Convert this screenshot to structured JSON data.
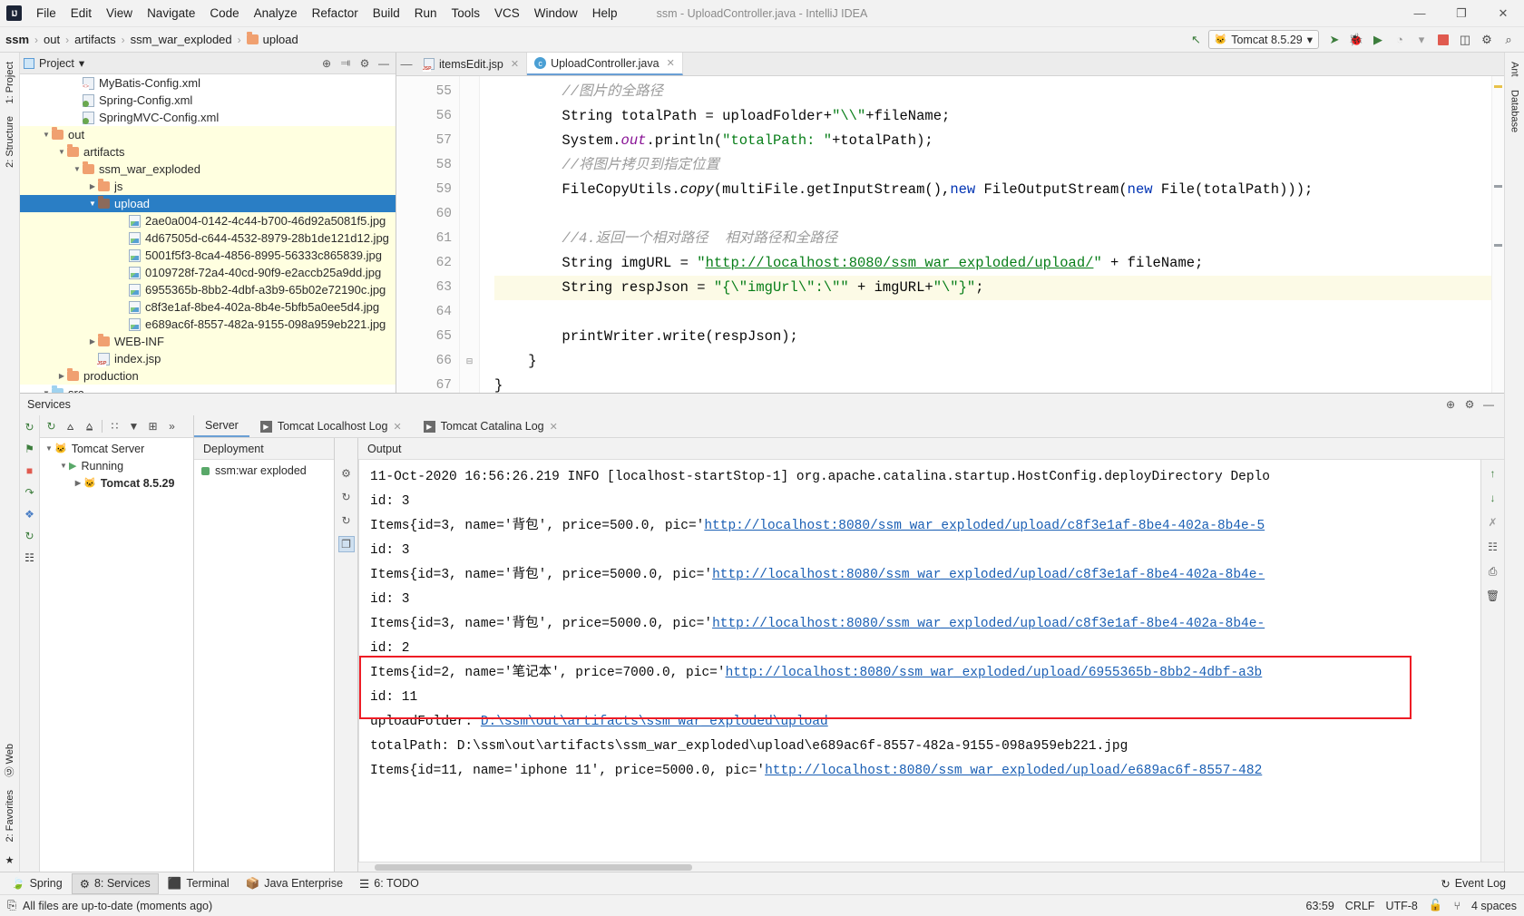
{
  "window": {
    "title": "ssm - UploadController.java - IntelliJ IDEA",
    "logo": "IJ",
    "minimize": "—",
    "maximize": "❐",
    "close": "✕"
  },
  "menu": {
    "items": [
      "File",
      "Edit",
      "View",
      "Navigate",
      "Code",
      "Analyze",
      "Refactor",
      "Build",
      "Run",
      "Tools",
      "VCS",
      "Window",
      "Help"
    ]
  },
  "navbar": {
    "crumbs": [
      "ssm",
      "out",
      "artifacts",
      "ssm_war_exploded",
      "upload"
    ],
    "separator": "›",
    "run_config": "Tomcat 8.5.29",
    "icons": {
      "build": "↖",
      "cat": "🐱",
      "dropdown": "▾",
      "run": "➤",
      "debug": "🐞",
      "run_coverage": "▶",
      "profile": "◔",
      "stop": "stop-icon",
      "settings": "⚙",
      "search": "⌕"
    }
  },
  "project_panel": {
    "title": "Project",
    "dropdown": "▾",
    "actions": [
      "⊕",
      "⫥",
      "⚙",
      "—"
    ],
    "tree": [
      {
        "label": "MyBatis-Config.xml",
        "indent": 3,
        "icon": "xml",
        "arrow": "",
        "state": "normal"
      },
      {
        "label": "Spring-Config.xml",
        "indent": 3,
        "icon": "xml-spring",
        "arrow": "",
        "state": "normal"
      },
      {
        "label": "SpringMVC-Config.xml",
        "indent": 3,
        "icon": "xml-spring",
        "arrow": "",
        "state": "normal"
      },
      {
        "label": "out",
        "indent": 1,
        "icon": "folder",
        "arrow": "▼",
        "state": "hl"
      },
      {
        "label": "artifacts",
        "indent": 2,
        "icon": "folder",
        "arrow": "▼",
        "state": "hl"
      },
      {
        "label": "ssm_war_exploded",
        "indent": 3,
        "icon": "folder",
        "arrow": "▼",
        "state": "hl"
      },
      {
        "label": "js",
        "indent": 4,
        "icon": "folder",
        "arrow": "▶",
        "state": "hl"
      },
      {
        "label": "upload",
        "indent": 4,
        "icon": "folder-dark",
        "arrow": "▼",
        "state": "sel"
      },
      {
        "label": "2ae0a004-0142-4c44-b700-46d92a5081f5.jpg",
        "indent": 6,
        "icon": "img",
        "arrow": "",
        "state": "hl"
      },
      {
        "label": "4d67505d-c644-4532-8979-28b1de121d12.jpg",
        "indent": 6,
        "icon": "img",
        "arrow": "",
        "state": "hl"
      },
      {
        "label": "5001f5f3-8ca4-4856-8995-56333c865839.jpg",
        "indent": 6,
        "icon": "img",
        "arrow": "",
        "state": "hl"
      },
      {
        "label": "0109728f-72a4-40cd-90f9-e2accb25a9dd.jpg",
        "indent": 6,
        "icon": "img",
        "arrow": "",
        "state": "hl"
      },
      {
        "label": "6955365b-8bb2-4dbf-a3b9-65b02e72190c.jpg",
        "indent": 6,
        "icon": "img",
        "arrow": "",
        "state": "hl"
      },
      {
        "label": "c8f3e1af-8be4-402a-8b4e-5bfb5a0ee5d4.jpg",
        "indent": 6,
        "icon": "img",
        "arrow": "",
        "state": "hl"
      },
      {
        "label": "e689ac6f-8557-482a-9155-098a959eb221.jpg",
        "indent": 6,
        "icon": "img",
        "arrow": "",
        "state": "hl"
      },
      {
        "label": "WEB-INF",
        "indent": 4,
        "icon": "folder",
        "arrow": "▶",
        "state": "hl"
      },
      {
        "label": "index.jsp",
        "indent": 4,
        "icon": "jsp",
        "arrow": "",
        "state": "hl"
      },
      {
        "label": "production",
        "indent": 2,
        "icon": "folder",
        "arrow": "▶",
        "state": "hl"
      },
      {
        "label": "src",
        "indent": 1,
        "icon": "folder-blue",
        "arrow": "▼",
        "state": "normal"
      }
    ]
  },
  "editor": {
    "tabs": [
      {
        "label": "itemsEdit.jsp",
        "icon": "jsp",
        "active": false,
        "close": "✕"
      },
      {
        "label": "UploadController.java",
        "icon": "java",
        "active": true,
        "close": "✕"
      }
    ],
    "lines": [
      {
        "no": "55",
        "current": false,
        "fold": "",
        "segments": [
          {
            "t": "        ",
            "c": ""
          },
          {
            "t": "//图片的全路径",
            "c": "cmt"
          }
        ]
      },
      {
        "no": "56",
        "current": false,
        "fold": "",
        "segments": [
          {
            "t": "        String totalPath = uploadFolder+",
            "c": ""
          },
          {
            "t": "\"\\\\\"",
            "c": "str"
          },
          {
            "t": "+fileName;",
            "c": ""
          }
        ]
      },
      {
        "no": "57",
        "current": false,
        "fold": "",
        "segments": [
          {
            "t": "        System.",
            "c": ""
          },
          {
            "t": "out",
            "c": "fld"
          },
          {
            "t": ".println(",
            "c": ""
          },
          {
            "t": "\"totalPath: \"",
            "c": "str"
          },
          {
            "t": "+totalPath);",
            "c": ""
          }
        ]
      },
      {
        "no": "58",
        "current": false,
        "fold": "",
        "segments": [
          {
            "t": "        ",
            "c": ""
          },
          {
            "t": "//将图片拷贝到指定位置",
            "c": "cmt"
          }
        ]
      },
      {
        "no": "59",
        "current": false,
        "fold": "",
        "segments": [
          {
            "t": "        FileCopyUtils.",
            "c": ""
          },
          {
            "t": "copy",
            "c": "mth"
          },
          {
            "t": "(multiFile.getInputStream(),",
            "c": ""
          },
          {
            "t": "new",
            "c": "kw"
          },
          {
            "t": " FileOutputStream(",
            "c": ""
          },
          {
            "t": "new",
            "c": "kw"
          },
          {
            "t": " File(totalPath)));",
            "c": ""
          }
        ]
      },
      {
        "no": "60",
        "current": false,
        "fold": "",
        "segments": [
          {
            "t": "",
            "c": ""
          }
        ]
      },
      {
        "no": "61",
        "current": false,
        "fold": "",
        "segments": [
          {
            "t": "        ",
            "c": ""
          },
          {
            "t": "//4.返回一个相对路径  相对路径和全路径",
            "c": "cmt"
          }
        ]
      },
      {
        "no": "62",
        "current": false,
        "fold": "",
        "segments": [
          {
            "t": "        String imgURL = ",
            "c": ""
          },
          {
            "t": "\"",
            "c": "str"
          },
          {
            "t": "http://localhost:8080/ssm_war_exploded/upload/",
            "c": "lnk"
          },
          {
            "t": "\"",
            "c": "str"
          },
          {
            "t": " + fileName;",
            "c": ""
          }
        ]
      },
      {
        "no": "63",
        "current": true,
        "fold": "",
        "segments": [
          {
            "t": "        String respJson = ",
            "c": ""
          },
          {
            "t": "\"{\\\"imgUrl\\\":\\\"\"",
            "c": "str"
          },
          {
            "t": " + imgURL+",
            "c": ""
          },
          {
            "t": "\"\\\"}\"",
            "c": "str"
          },
          {
            "t": ";",
            "c": ""
          }
        ]
      },
      {
        "no": "64",
        "current": false,
        "fold": "",
        "segments": [
          {
            "t": "",
            "c": ""
          }
        ]
      },
      {
        "no": "65",
        "current": false,
        "fold": "",
        "segments": [
          {
            "t": "        printWriter.write(respJson);",
            "c": ""
          }
        ]
      },
      {
        "no": "66",
        "current": false,
        "fold": "⊟",
        "segments": [
          {
            "t": "    }",
            "c": ""
          }
        ]
      },
      {
        "no": "67",
        "current": false,
        "fold": "",
        "segments": [
          {
            "t": "}",
            "c": ""
          }
        ]
      }
    ]
  },
  "services": {
    "title": "Services",
    "header_actions": [
      "⊕",
      "⚙",
      "—"
    ],
    "toolbar_icons": [
      "↻",
      "⩟",
      "⩠",
      "∷",
      "▼",
      "⊞",
      "»"
    ],
    "rail_icons": [
      "↻",
      "⚑",
      "■",
      "↷",
      "❖",
      "↻",
      "☷"
    ],
    "tree": [
      {
        "label": "Tomcat Server",
        "indent": 0,
        "arrow": "▼",
        "icon": "cat"
      },
      {
        "label": "Running",
        "indent": 1,
        "arrow": "▼",
        "icon": "play"
      },
      {
        "label": "Tomcat 8.5.29",
        "indent": 2,
        "arrow": "▶",
        "icon": "cat",
        "bold": true
      }
    ],
    "tabs": [
      {
        "label": "Server",
        "active": true,
        "icon": "",
        "close": ""
      },
      {
        "label": "Tomcat Localhost Log",
        "active": false,
        "icon": "play",
        "close": "✕"
      },
      {
        "label": "Tomcat Catalina Log",
        "active": false,
        "icon": "play",
        "close": "✕"
      }
    ],
    "deployment_header": "Deployment",
    "output_header": "Output",
    "deployment_item": "ssm:war exploded",
    "deploy_actions": [
      "⚙",
      "↻",
      "↻",
      "❐"
    ],
    "console_rail_icons": [
      "↑",
      "↓",
      "✗",
      "☷",
      "⎙",
      "Ὕ1"
    ],
    "console": [
      {
        "segments": [
          {
            "t": "11-Oct-2020 16:56:26.219 INFO [localhost-startStop-1] org.apache.catalina.startup.HostConfig.deployDirectory Deplo",
            "c": ""
          }
        ]
      },
      {
        "segments": [
          {
            "t": "id: 3",
            "c": ""
          }
        ]
      },
      {
        "segments": [
          {
            "t": "Items{id=3, name='背包', price=500.0, pic='",
            "c": ""
          },
          {
            "t": "http://localhost:8080/ssm_war_exploded/upload/c8f3e1af-8be4-402a-8b4e-5",
            "c": "link"
          }
        ]
      },
      {
        "segments": [
          {
            "t": "id: 3",
            "c": ""
          }
        ]
      },
      {
        "segments": [
          {
            "t": "Items{id=3, name='背包', price=5000.0, pic='",
            "c": ""
          },
          {
            "t": "http://localhost:8080/ssm_war_exploded/upload/c8f3e1af-8be4-402a-8b4e-",
            "c": "link"
          }
        ]
      },
      {
        "segments": [
          {
            "t": "id: 3",
            "c": ""
          }
        ]
      },
      {
        "segments": [
          {
            "t": "Items{id=3, name='背包', price=5000.0, pic='",
            "c": ""
          },
          {
            "t": "http://localhost:8080/ssm_war_exploded/upload/c8f3e1af-8be4-402a-8b4e-",
            "c": "link"
          }
        ]
      },
      {
        "segments": [
          {
            "t": "id: 2",
            "c": ""
          }
        ]
      },
      {
        "segments": [
          {
            "t": "Items{id=2, name='笔记本', price=7000.0, pic='",
            "c": ""
          },
          {
            "t": "http://localhost:8080/ssm_war_exploded/upload/6955365b-8bb2-4dbf-a3b",
            "c": "link"
          }
        ]
      },
      {
        "segments": [
          {
            "t": "id: 11",
            "c": ""
          }
        ]
      },
      {
        "segments": [
          {
            "t": "uploadFolder: ",
            "c": ""
          },
          {
            "t": "D:\\ssm\\out\\artifacts\\ssm_war_exploded\\upload",
            "c": "link"
          }
        ]
      },
      {
        "segments": [
          {
            "t": "totalPath: D:\\ssm\\out\\artifacts\\ssm_war_exploded\\upload\\e689ac6f-8557-482a-9155-098a959eb221.jpg",
            "c": ""
          }
        ]
      },
      {
        "segments": [
          {
            "t": "Items{id=11, name='iphone 11', price=5000.0, pic='",
            "c": ""
          },
          {
            "t": "http://localhost:8080/ssm_war_exploded/upload/e689ac6f-8557-482",
            "c": "link"
          }
        ]
      }
    ]
  },
  "left_rail": {
    "items": [
      "1: Project",
      "2: Structure"
    ]
  },
  "right_rail": {
    "items": [
      "Ant",
      "Database"
    ]
  },
  "left_rail_bottom": {
    "items": [
      "Ⓖ Web",
      "2: Favorites",
      "★"
    ]
  },
  "bottom_tabs": {
    "items": [
      {
        "label": "Spring",
        "icon": "🍃",
        "active": false
      },
      {
        "label": "8: Services",
        "icon": "⚙",
        "active": true
      },
      {
        "label": "Terminal",
        "icon": "⬛",
        "active": false
      },
      {
        "label": "Java Enterprise",
        "icon": "📦",
        "active": false
      },
      {
        "label": "6: TODO",
        "icon": "☰",
        "active": false
      }
    ],
    "event_log": "Event Log",
    "event_log_icon": "↻"
  },
  "statusbar": {
    "message": "All files are up-to-date (moments ago)",
    "message_icon": "⎘",
    "position": "63:59",
    "line_sep": "CRLF",
    "encoding": "UTF-8",
    "lock_icon": "🔓",
    "branch_icon": "⑂",
    "indent": "4 spaces"
  },
  "colors": {
    "accent": "#2a7ec5",
    "highlight_row": "#ffffe0",
    "annotation": "#ee1c25",
    "link": "#1a5fb4",
    "string": "#067d17",
    "keyword": "#0033b3",
    "comment": "#9b9b9b"
  }
}
